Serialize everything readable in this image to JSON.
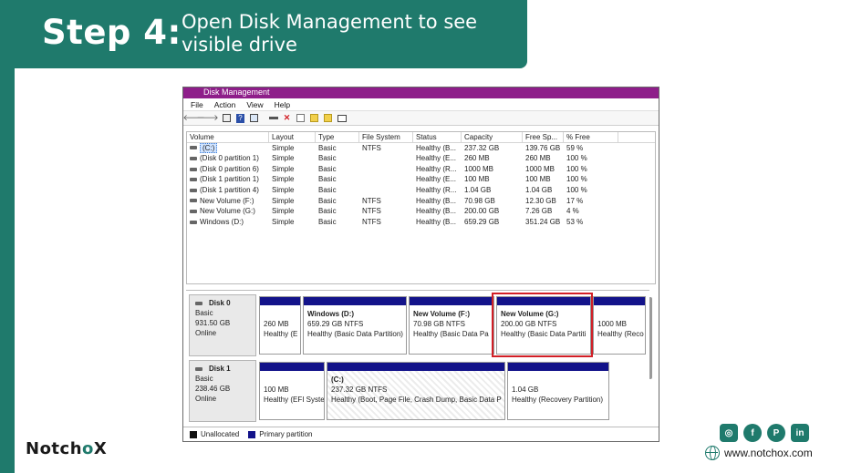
{
  "banner": {
    "step": "Step 4:",
    "description": "Open Disk Management to see visible drive"
  },
  "window": {
    "title": "Disk Management",
    "menu": [
      "File",
      "Action",
      "View",
      "Help"
    ],
    "toolbar_icons": [
      "back-icon",
      "forward-icon",
      "properties-icon",
      "help-icon",
      "list-icon",
      "connect-icon",
      "delete-icon",
      "check-icon",
      "new-icon",
      "open-icon",
      "view-icon"
    ],
    "columns": [
      "Volume",
      "Layout",
      "Type",
      "File System",
      "Status",
      "Capacity",
      "Free Sp...",
      "% Free"
    ],
    "volumes": [
      {
        "volume": "(C:)",
        "layout": "Simple",
        "type": "Basic",
        "fs": "NTFS",
        "status": "Healthy (B...",
        "capacity": "237.32 GB",
        "free": "139.76 GB",
        "pct": "59 %"
      },
      {
        "volume": "(Disk 0 partition 1)",
        "layout": "Simple",
        "type": "Basic",
        "fs": "",
        "status": "Healthy (E...",
        "capacity": "260 MB",
        "free": "260 MB",
        "pct": "100 %"
      },
      {
        "volume": "(Disk 0 partition 6)",
        "layout": "Simple",
        "type": "Basic",
        "fs": "",
        "status": "Healthy (R...",
        "capacity": "1000 MB",
        "free": "1000 MB",
        "pct": "100 %"
      },
      {
        "volume": "(Disk 1 partition 1)",
        "layout": "Simple",
        "type": "Basic",
        "fs": "",
        "status": "Healthy (E...",
        "capacity": "100 MB",
        "free": "100 MB",
        "pct": "100 %"
      },
      {
        "volume": "(Disk 1 partition 4)",
        "layout": "Simple",
        "type": "Basic",
        "fs": "",
        "status": "Healthy (R...",
        "capacity": "1.04 GB",
        "free": "1.04 GB",
        "pct": "100 %"
      },
      {
        "volume": "New Volume (F:)",
        "layout": "Simple",
        "type": "Basic",
        "fs": "NTFS",
        "status": "Healthy (B...",
        "capacity": "70.98 GB",
        "free": "12.30 GB",
        "pct": "17 %"
      },
      {
        "volume": "New Volume (G:)",
        "layout": "Simple",
        "type": "Basic",
        "fs": "NTFS",
        "status": "Healthy (B...",
        "capacity": "200.00 GB",
        "free": "7.26 GB",
        "pct": "4 %"
      },
      {
        "volume": "Windows (D:)",
        "layout": "Simple",
        "type": "Basic",
        "fs": "NTFS",
        "status": "Healthy (B...",
        "capacity": "659.29 GB",
        "free": "351.24 GB",
        "pct": "53 %"
      }
    ],
    "disk0": {
      "name": "Disk 0",
      "type": "Basic",
      "size": "931.50 GB",
      "state": "Online",
      "partitions": [
        {
          "name": "",
          "line1": "260 MB",
          "line2": "Healthy (E"
        },
        {
          "name": "Windows  (D:)",
          "line1": "659.29 GB NTFS",
          "line2": "Healthy (Basic Data Partition)"
        },
        {
          "name": "New Volume  (F:)",
          "line1": "70.98 GB NTFS",
          "line2": "Healthy (Basic Data Pa"
        },
        {
          "name": "New Volume  (G:)",
          "line1": "200.00 GB NTFS",
          "line2": "Healthy (Basic Data Partiti"
        },
        {
          "name": "",
          "line1": "1000 MB",
          "line2": "Healthy (Reco"
        }
      ]
    },
    "disk1": {
      "name": "Disk 1",
      "type": "Basic",
      "size": "238.46 GB",
      "state": "Online",
      "partitions": [
        {
          "name": "",
          "line1": "100 MB",
          "line2": "Healthy (EFI Syste"
        },
        {
          "name": "(C:)",
          "line1": "237.32 GB NTFS",
          "line2": "Healthy (Boot, Page File, Crash Dump, Basic Data P"
        },
        {
          "name": "",
          "line1": "1.04 GB",
          "line2": "Healthy (Recovery Partition)"
        }
      ]
    },
    "legend": {
      "unallocated": "Unallocated",
      "primary": "Primary partition"
    },
    "colors": {
      "unallocated": "#111111",
      "primary": "#13138a",
      "highlight": "#d21f26",
      "titlebar": "#8e1e8a"
    }
  },
  "brand": {
    "logo": "NotchoX",
    "website": "www.notchox.com",
    "social_icons": [
      "instagram-icon",
      "facebook-icon",
      "pinterest-icon",
      "linkedin-icon"
    ]
  },
  "theme": {
    "teal": "#1f7a6c"
  }
}
